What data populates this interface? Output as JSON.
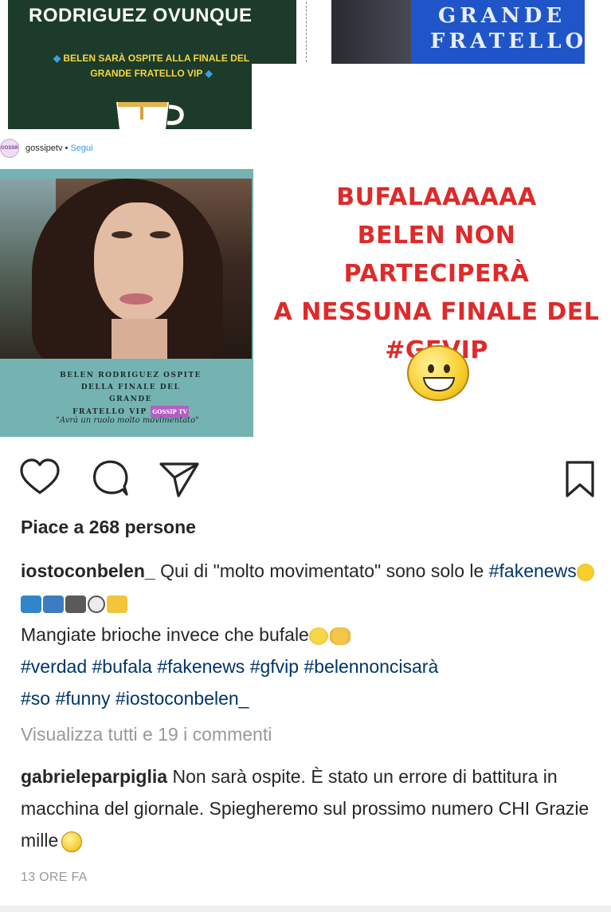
{
  "collage": {
    "news_headline": "RODRIGUEZ OVUNQUE",
    "news_sub_line1": "BELEN SARÀ OSPITE ALLA FINALE DEL",
    "news_sub_line2": "GRANDE FRATELLO VIP",
    "tv_logo_line1": "GRANDE",
    "tv_logo_line2": "FRATELLO",
    "embed": {
      "avatar_text": "GOSSIP",
      "username": "gossipetv",
      "separator": " • ",
      "follow": "Segui",
      "caption_line1": "BELEN RODRIGUEZ OSPITE",
      "caption_line2": "DELLA FINALE DEL GRANDE",
      "caption_line3": "FRATELLO VIP",
      "badge": "GOSSIP TV",
      "quote": "\"Avrà un ruolo molto movimentato\""
    },
    "red_note": {
      "line1": "BUFALAAAAAA",
      "line2": "BELEN NON PARTECIPERÀ",
      "line3": "A NESSUNA FINALE DEL",
      "line4": "#GFVIP"
    }
  },
  "actions": {
    "like_icon": "heart-icon",
    "comment_icon": "comment-icon",
    "share_icon": "send-icon",
    "save_icon": "bookmark-icon"
  },
  "post": {
    "likes_prefix": "Piace a ",
    "likes_count": "268",
    "likes_suffix": " persone",
    "caption_user": "iostoconbelen_",
    "caption_text_1": " Qui di \"molto movimentato\" sono solo le ",
    "caption_tag_fakenews": "#fakenews",
    "caption_line3": "Mangiate brioche invece che bufale",
    "hashtags_line1": "#verdad #bufala #fakenews #gfvip #belennoncisarà",
    "hashtags_line2": "#so #funny #iostoconbelen_",
    "view_all": "Visualizza tutti e 19 i commenti",
    "comment_user": "gabrieleparpiglia",
    "comment_text": " Non sarà ospite. È stato un errore di battitura in macchina del giornale. Spiegheremo sul prossimo numero CHI Grazie mille",
    "time_ago": "13 ORE FA"
  },
  "colors": {
    "text": "#262626",
    "hashtag": "#003569",
    "muted": "#999999",
    "red_note": "#de2a2a",
    "news_bg": "#1d3b2a",
    "news_sub": "#f4d640",
    "embed_teal": "#74b3b2"
  }
}
